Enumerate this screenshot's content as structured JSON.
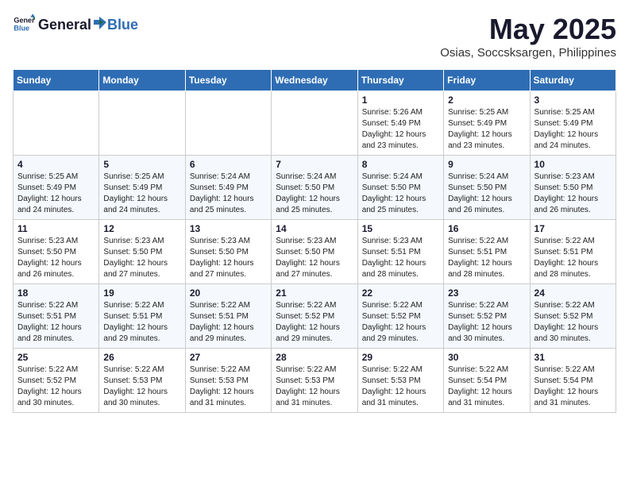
{
  "logo": {
    "text_general": "General",
    "text_blue": "Blue"
  },
  "title": "May 2025",
  "subtitle": "Osias, Soccsksargen, Philippines",
  "headers": [
    "Sunday",
    "Monday",
    "Tuesday",
    "Wednesday",
    "Thursday",
    "Friday",
    "Saturday"
  ],
  "weeks": [
    [
      {
        "day": "",
        "content": ""
      },
      {
        "day": "",
        "content": ""
      },
      {
        "day": "",
        "content": ""
      },
      {
        "day": "",
        "content": ""
      },
      {
        "day": "1",
        "content": "Sunrise: 5:26 AM\nSunset: 5:49 PM\nDaylight: 12 hours\nand 23 minutes."
      },
      {
        "day": "2",
        "content": "Sunrise: 5:25 AM\nSunset: 5:49 PM\nDaylight: 12 hours\nand 23 minutes."
      },
      {
        "day": "3",
        "content": "Sunrise: 5:25 AM\nSunset: 5:49 PM\nDaylight: 12 hours\nand 24 minutes."
      }
    ],
    [
      {
        "day": "4",
        "content": "Sunrise: 5:25 AM\nSunset: 5:49 PM\nDaylight: 12 hours\nand 24 minutes."
      },
      {
        "day": "5",
        "content": "Sunrise: 5:25 AM\nSunset: 5:49 PM\nDaylight: 12 hours\nand 24 minutes."
      },
      {
        "day": "6",
        "content": "Sunrise: 5:24 AM\nSunset: 5:49 PM\nDaylight: 12 hours\nand 25 minutes."
      },
      {
        "day": "7",
        "content": "Sunrise: 5:24 AM\nSunset: 5:50 PM\nDaylight: 12 hours\nand 25 minutes."
      },
      {
        "day": "8",
        "content": "Sunrise: 5:24 AM\nSunset: 5:50 PM\nDaylight: 12 hours\nand 25 minutes."
      },
      {
        "day": "9",
        "content": "Sunrise: 5:24 AM\nSunset: 5:50 PM\nDaylight: 12 hours\nand 26 minutes."
      },
      {
        "day": "10",
        "content": "Sunrise: 5:23 AM\nSunset: 5:50 PM\nDaylight: 12 hours\nand 26 minutes."
      }
    ],
    [
      {
        "day": "11",
        "content": "Sunrise: 5:23 AM\nSunset: 5:50 PM\nDaylight: 12 hours\nand 26 minutes."
      },
      {
        "day": "12",
        "content": "Sunrise: 5:23 AM\nSunset: 5:50 PM\nDaylight: 12 hours\nand 27 minutes."
      },
      {
        "day": "13",
        "content": "Sunrise: 5:23 AM\nSunset: 5:50 PM\nDaylight: 12 hours\nand 27 minutes."
      },
      {
        "day": "14",
        "content": "Sunrise: 5:23 AM\nSunset: 5:50 PM\nDaylight: 12 hours\nand 27 minutes."
      },
      {
        "day": "15",
        "content": "Sunrise: 5:23 AM\nSunset: 5:51 PM\nDaylight: 12 hours\nand 28 minutes."
      },
      {
        "day": "16",
        "content": "Sunrise: 5:22 AM\nSunset: 5:51 PM\nDaylight: 12 hours\nand 28 minutes."
      },
      {
        "day": "17",
        "content": "Sunrise: 5:22 AM\nSunset: 5:51 PM\nDaylight: 12 hours\nand 28 minutes."
      }
    ],
    [
      {
        "day": "18",
        "content": "Sunrise: 5:22 AM\nSunset: 5:51 PM\nDaylight: 12 hours\nand 28 minutes."
      },
      {
        "day": "19",
        "content": "Sunrise: 5:22 AM\nSunset: 5:51 PM\nDaylight: 12 hours\nand 29 minutes."
      },
      {
        "day": "20",
        "content": "Sunrise: 5:22 AM\nSunset: 5:51 PM\nDaylight: 12 hours\nand 29 minutes."
      },
      {
        "day": "21",
        "content": "Sunrise: 5:22 AM\nSunset: 5:52 PM\nDaylight: 12 hours\nand 29 minutes."
      },
      {
        "day": "22",
        "content": "Sunrise: 5:22 AM\nSunset: 5:52 PM\nDaylight: 12 hours\nand 29 minutes."
      },
      {
        "day": "23",
        "content": "Sunrise: 5:22 AM\nSunset: 5:52 PM\nDaylight: 12 hours\nand 30 minutes."
      },
      {
        "day": "24",
        "content": "Sunrise: 5:22 AM\nSunset: 5:52 PM\nDaylight: 12 hours\nand 30 minutes."
      }
    ],
    [
      {
        "day": "25",
        "content": "Sunrise: 5:22 AM\nSunset: 5:52 PM\nDaylight: 12 hours\nand 30 minutes."
      },
      {
        "day": "26",
        "content": "Sunrise: 5:22 AM\nSunset: 5:53 PM\nDaylight: 12 hours\nand 30 minutes."
      },
      {
        "day": "27",
        "content": "Sunrise: 5:22 AM\nSunset: 5:53 PM\nDaylight: 12 hours\nand 31 minutes."
      },
      {
        "day": "28",
        "content": "Sunrise: 5:22 AM\nSunset: 5:53 PM\nDaylight: 12 hours\nand 31 minutes."
      },
      {
        "day": "29",
        "content": "Sunrise: 5:22 AM\nSunset: 5:53 PM\nDaylight: 12 hours\nand 31 minutes."
      },
      {
        "day": "30",
        "content": "Sunrise: 5:22 AM\nSunset: 5:54 PM\nDaylight: 12 hours\nand 31 minutes."
      },
      {
        "day": "31",
        "content": "Sunrise: 5:22 AM\nSunset: 5:54 PM\nDaylight: 12 hours\nand 31 minutes."
      }
    ]
  ]
}
